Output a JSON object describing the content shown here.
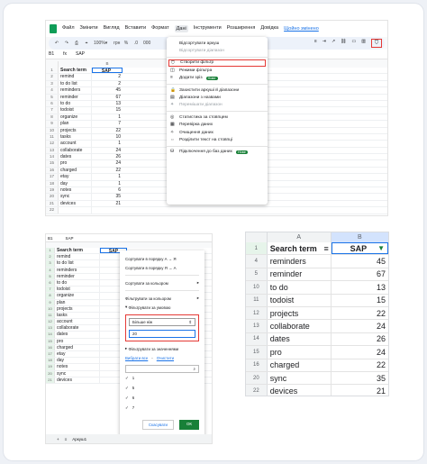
{
  "panel_a": {
    "menu": [
      "Файл",
      "Змінити",
      "Вигляд",
      "Вставити",
      "Формат",
      "Дані",
      "Інструменти",
      "Розширення",
      "Довідка"
    ],
    "menu_link": "Щойно змінено",
    "toolbar": [
      "↶",
      "↷",
      "⎙",
      "⌖",
      "100%",
      "▾",
      "грн",
      "%",
      ".0",
      "000"
    ],
    "cell_ref": "B1",
    "fx": "fx",
    "formula": "SAP",
    "col_b": "B",
    "rows": [
      {
        "n": "1",
        "a": "Search term",
        "b": "SAP"
      },
      {
        "n": "2",
        "a": "remind",
        "b": "2"
      },
      {
        "n": "3",
        "a": "to do list",
        "b": "2"
      },
      {
        "n": "4",
        "a": "reminders",
        "b": "45"
      },
      {
        "n": "5",
        "a": "reminder",
        "b": "67"
      },
      {
        "n": "6",
        "a": "to do",
        "b": "13"
      },
      {
        "n": "7",
        "a": "todoist",
        "b": "15"
      },
      {
        "n": "8",
        "a": "organize",
        "b": "1"
      },
      {
        "n": "9",
        "a": "plan",
        "b": "7"
      },
      {
        "n": "10",
        "a": "projects",
        "b": "22"
      },
      {
        "n": "11",
        "a": "tasks",
        "b": "10"
      },
      {
        "n": "12",
        "a": "account",
        "b": "1"
      },
      {
        "n": "13",
        "a": "collaborate",
        "b": "24"
      },
      {
        "n": "14",
        "a": "dates",
        "b": "26"
      },
      {
        "n": "15",
        "a": "pro",
        "b": "24"
      },
      {
        "n": "16",
        "a": "charged",
        "b": "22"
      },
      {
        "n": "17",
        "a": "etay",
        "b": "1"
      },
      {
        "n": "18",
        "a": "day",
        "b": "1"
      },
      {
        "n": "19",
        "a": "notes",
        "b": "6"
      },
      {
        "n": "20",
        "a": "sync",
        "b": "35"
      },
      {
        "n": "21",
        "a": "devices",
        "b": "21"
      },
      {
        "n": "22",
        "a": "",
        "b": ""
      }
    ],
    "dropdown": [
      {
        "label": "Відсортувати аркуш",
        "type": "item"
      },
      {
        "label": "Відсортувати діапазон",
        "type": "dim"
      },
      {
        "type": "sep"
      },
      {
        "label": "Створити фільтр",
        "type": "hl",
        "icon": "⛉"
      },
      {
        "label": "Режими фільтра",
        "type": "item",
        "icon": "◫"
      },
      {
        "label": "Додати зріз",
        "type": "item",
        "icon": "≡",
        "badge": "Нове"
      },
      {
        "type": "sep"
      },
      {
        "label": "Захистити аркуші й діапазони",
        "type": "item",
        "icon": "🔒"
      },
      {
        "label": "Діапазони з назвами",
        "type": "item",
        "icon": "▤"
      },
      {
        "label": "Перемішати діапазон",
        "type": "dim",
        "icon": "✦"
      },
      {
        "type": "sep"
      },
      {
        "label": "Статистика за стовпцем",
        "type": "item",
        "icon": "◎"
      },
      {
        "label": "Перевірка даних",
        "type": "item",
        "icon": "▦"
      },
      {
        "label": "Очищення даних",
        "type": "item",
        "icon": "✧"
      },
      {
        "label": "Розділити текст на стовпці",
        "type": "item",
        "icon": "⇔"
      },
      {
        "type": "sep"
      },
      {
        "label": "Підключення до баз даних",
        "type": "item",
        "icon": "⛁",
        "badge": "Нове"
      }
    ]
  },
  "panel_b": {
    "cell_ref": "B1",
    "formula": "SAP",
    "rows": [
      {
        "n": "1",
        "a": "Search term",
        "b": "SAP"
      },
      {
        "n": "2",
        "a": "remind",
        "b": ""
      },
      {
        "n": "3",
        "a": "to do list",
        "b": ""
      },
      {
        "n": "4",
        "a": "reminders",
        "b": ""
      },
      {
        "n": "5",
        "a": "reminder",
        "b": ""
      },
      {
        "n": "6",
        "a": "to do",
        "b": ""
      },
      {
        "n": "7",
        "a": "todoist",
        "b": ""
      },
      {
        "n": "8",
        "a": "organize",
        "b": ""
      },
      {
        "n": "9",
        "a": "plan",
        "b": ""
      },
      {
        "n": "10",
        "a": "projects",
        "b": ""
      },
      {
        "n": "11",
        "a": "tasks",
        "b": ""
      },
      {
        "n": "12",
        "a": "account",
        "b": ""
      },
      {
        "n": "13",
        "a": "collaborate",
        "b": ""
      },
      {
        "n": "14",
        "a": "dates",
        "b": ""
      },
      {
        "n": "15",
        "a": "pro",
        "b": ""
      },
      {
        "n": "16",
        "a": "charged",
        "b": ""
      },
      {
        "n": "17",
        "a": "etay",
        "b": ""
      },
      {
        "n": "18",
        "a": "day",
        "b": ""
      },
      {
        "n": "19",
        "a": "notes",
        "b": ""
      },
      {
        "n": "20",
        "a": "sync",
        "b": ""
      },
      {
        "n": "21",
        "a": "devices",
        "b": ""
      }
    ],
    "sort_asc": "Сортувати в порядку А → Я",
    "sort_desc": "Сортувати в порядку Я → А",
    "sort_color": "Сортувати за кольором",
    "filter_color": "Фільтрувати за кольором",
    "filter_cond": "Фільтрувати за умовою",
    "cond_select": "Більше ніж",
    "cond_value": "20",
    "filter_values": "Фільтрувати за значеннями",
    "select_all": "Вибрати все",
    "clear": "Очистити",
    "checks": [
      "1",
      "5",
      "6",
      "7"
    ],
    "cancel": "Скасувати",
    "ok": "ОК",
    "tab1": "Аркуш",
    "tab2": "таку кількість рядк",
    "sheet_tab": "Аркуш1"
  },
  "panel_c": {
    "col_a": "A",
    "col_b": "B",
    "rows": [
      {
        "n": "1",
        "a": "Search term",
        "b": "SAP"
      },
      {
        "n": "4",
        "a": "reminders",
        "b": "45"
      },
      {
        "n": "5",
        "a": "reminder",
        "b": "67"
      },
      {
        "n": "10",
        "a": "to do",
        "b": "13"
      },
      {
        "n": "11",
        "a": "todoist",
        "b": "15"
      },
      {
        "n": "12",
        "a": "projects",
        "b": "22"
      },
      {
        "n": "13",
        "a": "collaborate",
        "b": "24"
      },
      {
        "n": "14",
        "a": "dates",
        "b": "26"
      },
      {
        "n": "15",
        "a": "pro",
        "b": "24"
      },
      {
        "n": "16",
        "a": "charged",
        "b": "22"
      },
      {
        "n": "20",
        "a": "sync",
        "b": "35"
      },
      {
        "n": "22",
        "a": "devices",
        "b": "21"
      }
    ]
  }
}
